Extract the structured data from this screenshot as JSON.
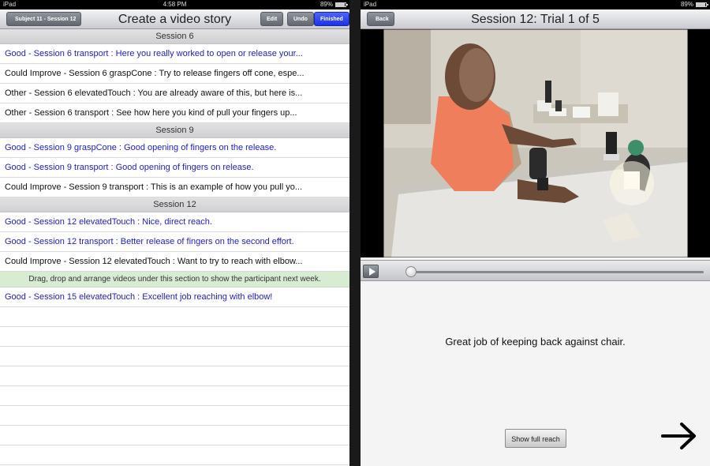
{
  "left": {
    "status": {
      "carrier": "iPad",
      "time": "4:58 PM",
      "battery": "89%"
    },
    "nav": {
      "back_label": "Subject 11 - Session 12",
      "title": "Create a video story",
      "edit_label": "Edit",
      "undo_label": "Undo",
      "finished_label": "Finished"
    },
    "sections": [
      {
        "header": "Session 6",
        "rows": [
          {
            "text": "Good - Session 6 transport : Here you really worked to open or release your...",
            "kind": "good"
          },
          {
            "text": "Could Improve - Session 6 graspCone : Try to release fingers off cone, espe...",
            "kind": "neutral"
          },
          {
            "text": "Other - Session 6 elevatedTouch : You are already aware of this, but here is...",
            "kind": "neutral"
          },
          {
            "text": "Other - Session 6 transport : See how here you kind of pull your fingers up...",
            "kind": "neutral"
          }
        ]
      },
      {
        "header": "Session 9",
        "rows": [
          {
            "text": "Good - Session 9 graspCone : Good opening of fingers on the release.",
            "kind": "good"
          },
          {
            "text": "Good - Session 9 transport : Good opening of fingers on release.",
            "kind": "good"
          },
          {
            "text": "Could Improve - Session 9 transport : This is an example of how you pull yo...",
            "kind": "neutral"
          }
        ]
      },
      {
        "header": "Session 12",
        "rows": [
          {
            "text": "Good - Session 12 elevatedTouch : Nice, direct reach.",
            "kind": "good"
          },
          {
            "text": "Good - Session 12 transport : Better release of fingers on the second effort.",
            "kind": "good"
          },
          {
            "text": "Could Improve - Session 12 elevatedTouch : Want to try to reach with elbow...",
            "kind": "neutral"
          }
        ]
      }
    ],
    "drop_zone": "Drag, drop and arrange videos under this section to show the participant next week.",
    "next_week_rows": [
      {
        "text": "Good - Session 15 elevatedTouch : Excellent job reaching with elbow!",
        "kind": "good"
      }
    ]
  },
  "right": {
    "status": {
      "carrier": "iPad",
      "time": "",
      "battery": "89%"
    },
    "nav": {
      "back_label": "Back",
      "title": "Session 12: Trial 1 of 5"
    },
    "player": {
      "progress": 0.0
    },
    "comment": "Great job of keeping back against chair.",
    "show_full_reach_label": "Show full reach",
    "colors": {
      "good_text": "#1c1cd6",
      "finished_button": "#1a32e6",
      "drop_zone_bg": "#d7ecd2"
    }
  }
}
